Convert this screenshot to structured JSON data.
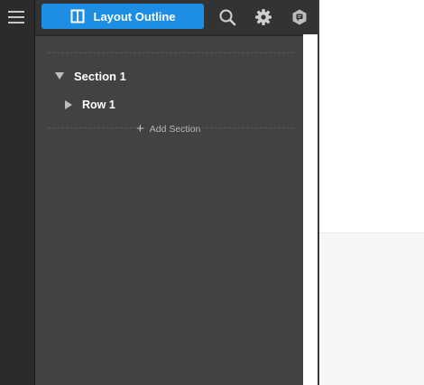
{
  "toolbar": {
    "layout_outline_label": "Layout Outline",
    "icons": [
      "menu-icon",
      "layout-icon",
      "search-icon",
      "gear-icon",
      "hexagon-chat-icon"
    ]
  },
  "outline": {
    "section": {
      "label": "Section 1"
    },
    "row": {
      "label": "Row 1"
    },
    "add_section_label": "Add Section"
  },
  "colors": {
    "accent": "#1e8ee4",
    "panel": "#424242",
    "rail": "#2b2b2b"
  }
}
